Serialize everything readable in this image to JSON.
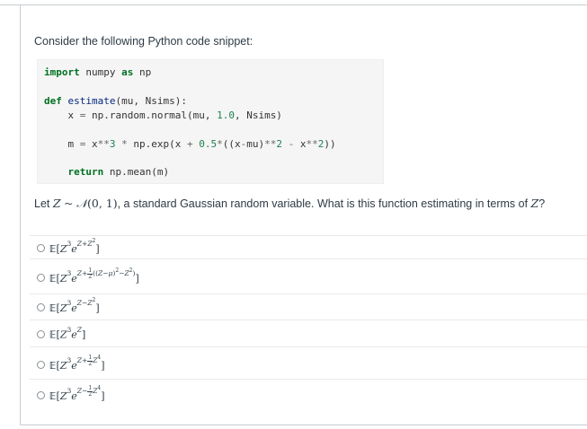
{
  "question": {
    "prompt": "Consider the following Python code snippet:",
    "code_lines": [
      "import numpy as np",
      "def estimate(mu, Nsims):",
      "    x = np.random.normal(mu, 1.0, Nsims)",
      "    m = x**3 * np.exp(x + 0.5*((x-mu)**2 - x**2))",
      "    return np.mean(m)"
    ],
    "text_before": "Let ",
    "text_dist": "Z ~ N(0, 1)",
    "text_after": ", a standard Gaussian random variable. What is this function estimating in terms of ",
    "text_var": "Z",
    "text_end": "?"
  },
  "answers": [
    {
      "label": "E[Z^3 e^{Z+Z^2}]"
    },
    {
      "label": "E[Z^3 e^{Z+1/2((Z-mu)^2 - Z^2)}]"
    },
    {
      "label": "E[Z^3 e^{Z-Z^2}]"
    },
    {
      "label": "E[Z^3 e^Z]"
    },
    {
      "label": "E[Z^3 e^{Z+1/2 Z^4}]"
    },
    {
      "label": "E[Z^3 e^{Z-1/2 Z^4}]"
    }
  ]
}
